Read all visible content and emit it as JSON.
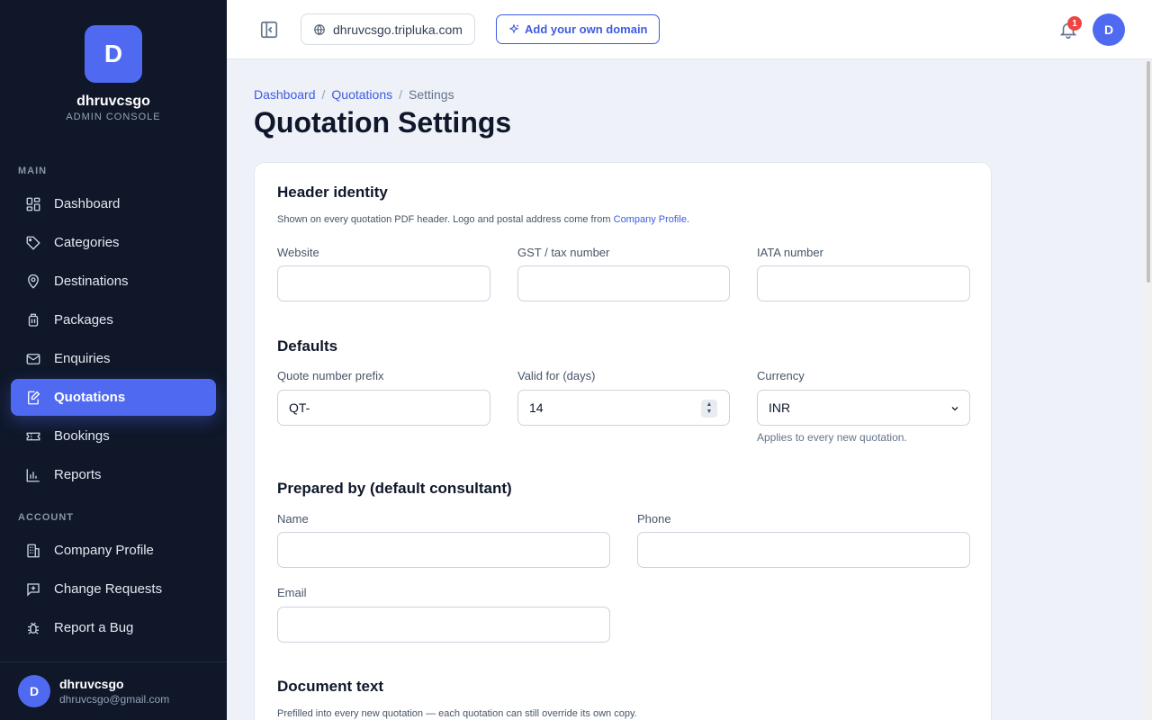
{
  "brand": {
    "initial": "D",
    "name": "dhruvcsgo",
    "subtitle": "ADMIN CONSOLE"
  },
  "sidebar": {
    "main_label": "MAIN",
    "account_label": "ACCOUNT",
    "main_items": [
      {
        "label": "Dashboard",
        "icon": "grid-icon"
      },
      {
        "label": "Categories",
        "icon": "tag-icon"
      },
      {
        "label": "Destinations",
        "icon": "map-pin-icon"
      },
      {
        "label": "Packages",
        "icon": "luggage-icon"
      },
      {
        "label": "Enquiries",
        "icon": "mail-icon"
      },
      {
        "label": "Quotations",
        "icon": "edit-document-icon",
        "active": true
      },
      {
        "label": "Bookings",
        "icon": "ticket-icon"
      },
      {
        "label": "Reports",
        "icon": "bar-chart-icon"
      }
    ],
    "account_items": [
      {
        "label": "Company Profile",
        "icon": "building-icon"
      },
      {
        "label": "Change Requests",
        "icon": "message-plus-icon"
      },
      {
        "label": "Report a Bug",
        "icon": "bug-icon"
      }
    ],
    "user": {
      "initial": "D",
      "name": "dhruvcsgo",
      "email": "dhruvcsgo@gmail.com"
    }
  },
  "topbar": {
    "domain": "dhruvcsgo.tripluka.com",
    "add_domain_label": "Add your own domain",
    "notification_count": "1",
    "avatar_initial": "D"
  },
  "breadcrumb": {
    "items": [
      "Dashboard",
      "Quotations",
      "Settings"
    ],
    "separator": "/"
  },
  "page_title": "Quotation Settings",
  "header_identity": {
    "title": "Header identity",
    "help_prefix": "Shown on every quotation PDF header. Logo and postal address come from ",
    "help_link": "Company Profile",
    "help_suffix": ".",
    "website_label": "Website",
    "website_value": "",
    "gst_label": "GST / tax number",
    "gst_value": "",
    "iata_label": "IATA number",
    "iata_value": ""
  },
  "defaults": {
    "title": "Defaults",
    "prefix_label": "Quote number prefix",
    "prefix_value": "QT-",
    "valid_label": "Valid for (days)",
    "valid_value": "14",
    "currency_label": "Currency",
    "currency_value": "INR",
    "currency_hint": "Applies to every new quotation."
  },
  "prepared_by": {
    "title": "Prepared by (default consultant)",
    "name_label": "Name",
    "name_value": "",
    "phone_label": "Phone",
    "phone_value": "",
    "email_label": "Email",
    "email_value": ""
  },
  "document_text": {
    "title": "Document text",
    "help": "Prefilled into every new quotation — each quotation can still override its own copy."
  },
  "colors": {
    "accent": "#4f6af0",
    "sidebar_bg": "#0f1729",
    "badge": "#ef4444"
  }
}
